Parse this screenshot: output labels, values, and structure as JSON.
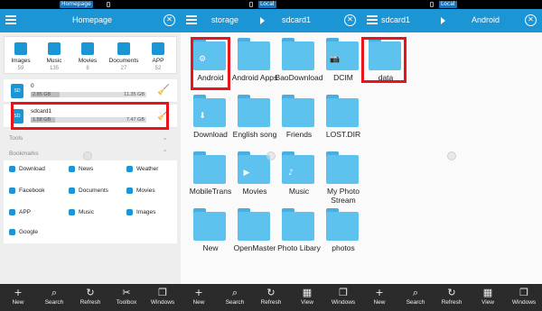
{
  "panels": [
    {
      "status_tab": "Homepage",
      "title": "Homepage",
      "categories": [
        {
          "label": "Images",
          "count": "59",
          "icon": "image-icon"
        },
        {
          "label": "Music",
          "count": "135",
          "icon": "music-icon"
        },
        {
          "label": "Movies",
          "count": "8",
          "icon": "movie-icon"
        },
        {
          "label": "Documents",
          "count": "27",
          "icon": "document-icon"
        },
        {
          "label": "APP",
          "count": "52",
          "icon": "app-icon"
        }
      ],
      "storage": [
        {
          "name": "0",
          "used": "2.85 GB",
          "total": "11.35 GB",
          "fill": 0.25
        },
        {
          "name": "sdcard1",
          "used": "1.58 GB",
          "total": "7.47 GB",
          "fill": 0.21
        }
      ],
      "tools_label": "Tools",
      "bookmarks_label": "Bookmarks",
      "bookmarks": [
        [
          "Download",
          "News",
          "Weather"
        ],
        [
          "Facebook",
          "Documents",
          "Movies"
        ],
        [
          "APP",
          "Music",
          "Images"
        ],
        [
          "Google"
        ]
      ],
      "bottom": [
        "New",
        "Search",
        "Refresh",
        "Toolbox",
        "Windows"
      ]
    },
    {
      "status_tab": "Local",
      "path": [
        "storage",
        "sdcard1"
      ],
      "folders": [
        {
          "label": "Android",
          "badge": "⚙"
        },
        {
          "label": "Android Apps",
          "badge": ""
        },
        {
          "label": "BaoDownload",
          "badge": ""
        },
        {
          "label": "DCIM",
          "badge": "📷"
        },
        {
          "label": "Download",
          "badge": "⬇"
        },
        {
          "label": "English song",
          "badge": ""
        },
        {
          "label": "Friends",
          "badge": ""
        },
        {
          "label": "LOST.DIR",
          "badge": ""
        },
        {
          "label": "MobileTrans",
          "badge": ""
        },
        {
          "label": "Movies",
          "badge": "▶"
        },
        {
          "label": "Music",
          "badge": "♪"
        },
        {
          "label": "My Photo Stream",
          "badge": ""
        },
        {
          "label": "New",
          "badge": ""
        },
        {
          "label": "OpenMaster",
          "badge": ""
        },
        {
          "label": "Photo Libary",
          "badge": ""
        },
        {
          "label": "photos",
          "badge": ""
        }
      ],
      "bottom": [
        "New",
        "Search",
        "Refresh",
        "View",
        "Windows"
      ]
    },
    {
      "status_tab": "Local",
      "path": [
        "sdcard1",
        "Android"
      ],
      "folders": [
        {
          "label": "data",
          "badge": ""
        }
      ],
      "bottom": [
        "New",
        "Search",
        "Refresh",
        "View",
        "Windows"
      ]
    }
  ],
  "colors": {
    "accent": "#1b95d3",
    "folder": "#5ec2ef",
    "highlight": "#e8141a",
    "bottombar": "#2b2b2b"
  }
}
